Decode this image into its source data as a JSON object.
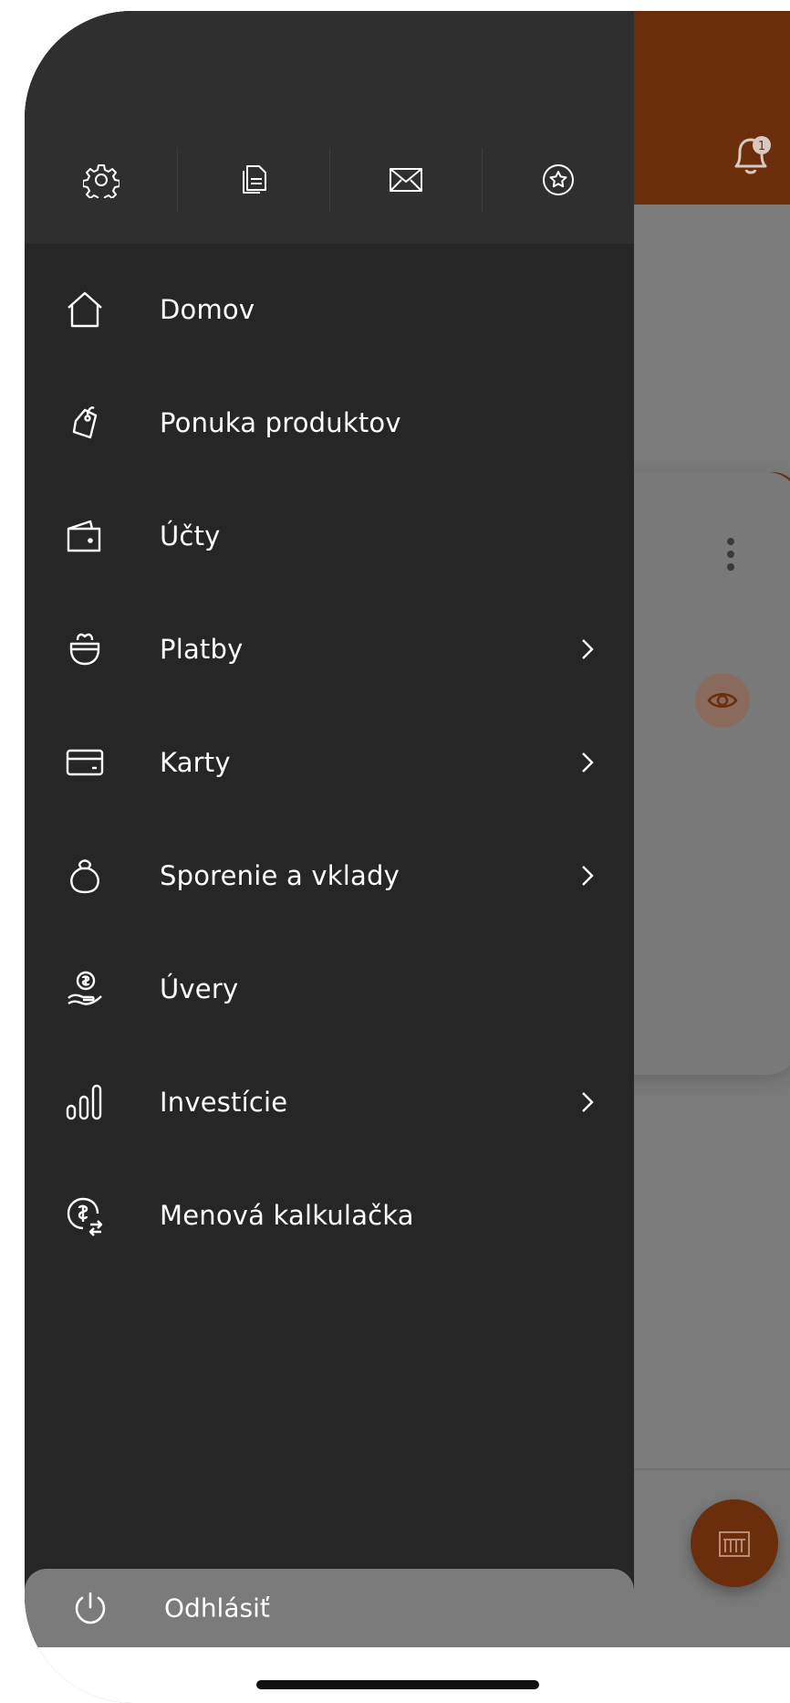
{
  "background": {
    "header_color": "#6b2e0c",
    "notification_count": "1"
  },
  "drawer": {
    "top_icons": [
      {
        "name": "settings-icon"
      },
      {
        "name": "documents-icon"
      },
      {
        "name": "mail-icon"
      },
      {
        "name": "star-badge-icon"
      }
    ],
    "items": [
      {
        "label": "Domov",
        "icon": "home-icon",
        "has_submenu": false
      },
      {
        "label": "Ponuka produktov",
        "icon": "tag-icon",
        "has_submenu": false
      },
      {
        "label": "Účty",
        "icon": "wallet-icon",
        "has_submenu": false
      },
      {
        "label": "Platby",
        "icon": "payments-icon",
        "has_submenu": true
      },
      {
        "label": "Karty",
        "icon": "card-icon",
        "has_submenu": true
      },
      {
        "label": "Sporenie a vklady",
        "icon": "savings-icon",
        "has_submenu": true
      },
      {
        "label": "Úvery",
        "icon": "loan-icon",
        "has_submenu": false
      },
      {
        "label": "Investície",
        "icon": "investments-icon",
        "has_submenu": true
      },
      {
        "label": "Menová kalkulačka",
        "icon": "currency-calculator-icon",
        "has_submenu": false
      }
    ],
    "logout_label": "Odhlásiť"
  },
  "colors": {
    "drawer_bg": "#262626",
    "drawer_top_bg": "#2f2f2f",
    "logout_bg": "#7b7b7b",
    "accent": "#6b2e0c"
  }
}
